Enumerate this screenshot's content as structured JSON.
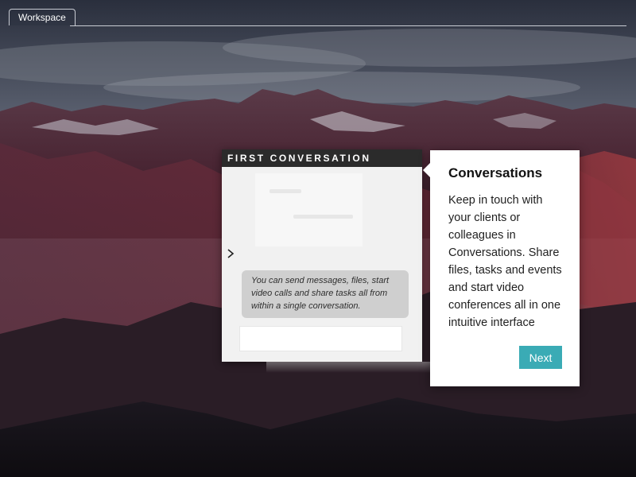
{
  "workspace_tab": {
    "label": "Workspace"
  },
  "preview": {
    "header": "FIRST CONVERSATION",
    "bubble_text": "You can send messages, files, start video calls and share tasks all from within a single conversation.",
    "input_value": ""
  },
  "tooltip": {
    "title": "Conversations",
    "body": "Keep in touch with your clients or colleagues in Conversations. Share files, tasks and events and start video conferences all in one intuitive interface",
    "next_label": "Next"
  },
  "icons": {
    "expand": "chevron-right-icon"
  },
  "colors": {
    "accent": "#3aabb5",
    "header_bg": "#2b2b2b",
    "bubble_bg": "#cfcfcf"
  }
}
